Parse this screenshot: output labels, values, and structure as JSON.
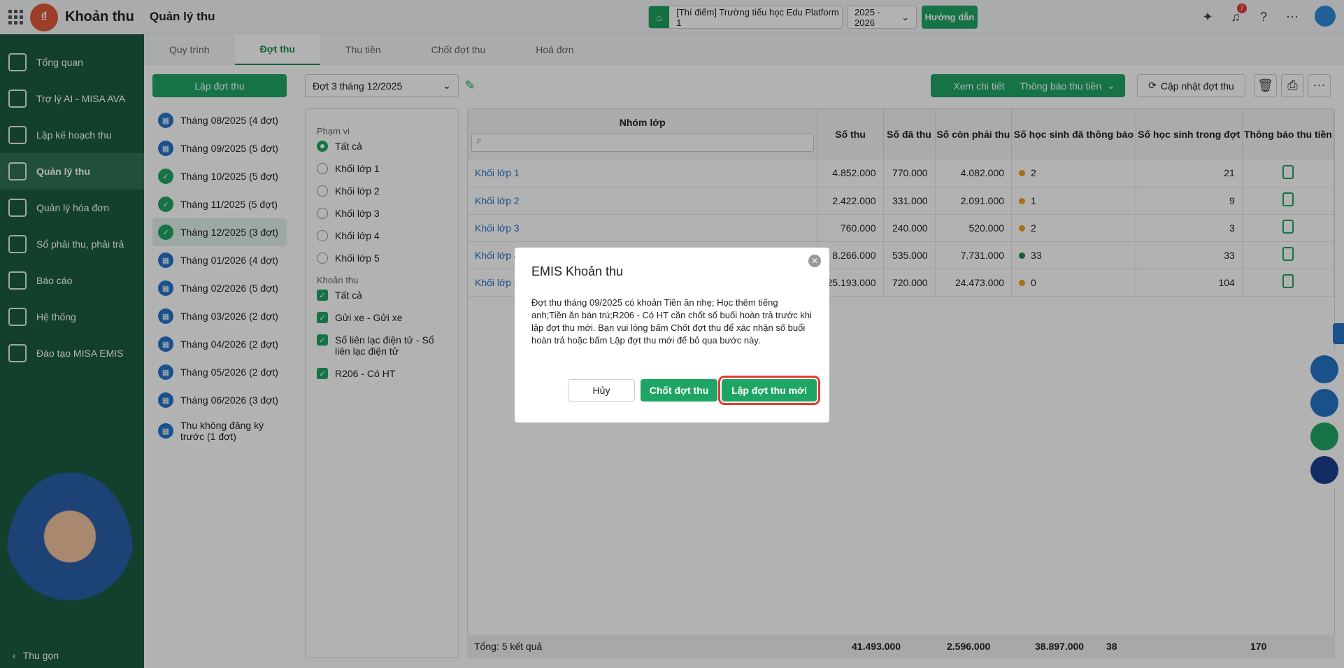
{
  "app": {
    "name": "Khoản thu",
    "page_title": "Quản lý thu"
  },
  "top": {
    "school": "[Thí điểm] Trường tiểu học Edu Platform 1",
    "year": "2025 - 2026",
    "guide": "Hướng dẫn",
    "notif_count": "7"
  },
  "nav": [
    "Tổng quan",
    "Trợ lý AI - MISA AVA",
    "Lập kế hoạch thu",
    "Quản lý thu",
    "Quản lý hóa đơn",
    "Sổ phải thu, phải trả",
    "Báo cáo",
    "Hệ thống",
    "Đào tạo MISA EMIS"
  ],
  "collapse": "Thu gọn",
  "tabs": [
    "Quy trình",
    "Đợt thu",
    "Thu tiền",
    "Chốt đợt thu",
    "Hoá đơn"
  ],
  "actions": {
    "create": "Lập đợt thu",
    "period": "Đợt 3 tháng 12/2025",
    "detail": "Xem chi tiết",
    "notify": "Thông báo thu tiền",
    "update": "Cập nhật đợt thu"
  },
  "periods": [
    "Tháng 08/2025 (4 đợt)",
    "Tháng 09/2025 (5 đợt)",
    "Tháng 10/2025 (5 đợt)",
    "Tháng 11/2025 (5 đợt)",
    "Tháng 12/2025 (3 đợt)",
    "Tháng 01/2026 (4 đợt)",
    "Tháng 02/2026 (5 đợt)",
    "Tháng 03/2026 (2 đợt)",
    "Tháng 04/2026 (2 đợt)",
    "Tháng 05/2026 (2 đợt)",
    "Tháng 06/2026 (3 đợt)",
    "Thu không đăng ký trước (1 đợt)"
  ],
  "filter": {
    "scope_label": "Phạm vi",
    "scopes": [
      "Tất cả",
      "Khối lớp 1",
      "Khối lớp 2",
      "Khối lớp 3",
      "Khối lớp 4",
      "Khối lớp 5"
    ],
    "fee_label": "Khoản thu",
    "fees": [
      "Tất cả",
      "Gửi xe - Gửi xe",
      "Sổ liên lạc điện tử - Sổ liên lạc điện tử",
      "R206 - Có HT"
    ]
  },
  "table": {
    "headers": [
      "Nhóm lớp",
      "Số thu",
      "Số đã thu",
      "Số còn phải thu",
      "Số học sinh đã thông báo",
      "Số học sinh trong đợt",
      "Thông báo thu tiền"
    ],
    "rows": [
      [
        "Khối lớp 1",
        "4.852.000",
        "770.000",
        "4.082.000",
        "2",
        "21"
      ],
      [
        "Khối lớp 2",
        "2.422.000",
        "331.000",
        "2.091.000",
        "1",
        "9"
      ],
      [
        "Khối lớp 3",
        "760.000",
        "240.000",
        "520.000",
        "2",
        "3"
      ],
      [
        "Khối lớp 4",
        "8.266.000",
        "535.000",
        "7.731.000",
        "33",
        "33"
      ],
      [
        "Khối lớp 5",
        "25.193.000",
        "720.000",
        "24.473.000",
        "0",
        "104"
      ]
    ],
    "footer": {
      "total_label": "Tổng: 5 kết quả",
      "sum": "41.493.000",
      "paid": "2.596.000",
      "remain": "38.897.000",
      "notified": "38",
      "students": "170"
    }
  },
  "dialog": {
    "title": "EMIS Khoản thu",
    "message": "Đợt thu tháng 09/2025 có khoản Tiền ăn nhẹ; Học thêm tiếng anh;Tiền ăn bán trú;R206 - Có HT cần chốt số buổi hoàn trả trước khi lập đợt thu mới. Bạn vui lòng bấm Chốt đợt thu để xác nhận số buổi hoàn trả hoặc bấm Lập đợt thu mới để bỏ qua bước này.",
    "cancel": "Hủy",
    "close_period": "Chốt đợt thu",
    "new_period": "Lập đợt thu mới"
  }
}
